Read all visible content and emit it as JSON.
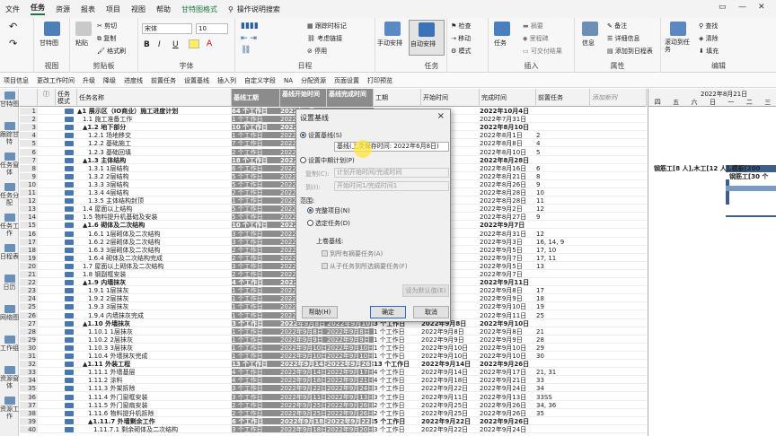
{
  "menu": {
    "items": [
      "文件",
      "任务",
      "资源",
      "报表",
      "项目",
      "视图",
      "帮助",
      "甘特图格式"
    ],
    "active_index": 1,
    "search": "操作说明搜索"
  },
  "ribbon": {
    "gantt_label": "甘特图",
    "paste_label": "粘贴",
    "cut": "剪切",
    "copy": "复制",
    "format_painter": "格式刷",
    "font_name": "宋体",
    "font_size": "10",
    "bold": "B",
    "italic": "I",
    "underline": "U",
    "mark_on_track": "跟踪时标记",
    "respect_links": "考虑链接",
    "inactivate": "停用",
    "manual_schedule": "手动安排",
    "auto_schedule": "自动安排",
    "inspect": "检查",
    "move": "移动",
    "mode": "模式",
    "task": "任务",
    "summary": "摘要",
    "milestone": "里程碑",
    "deliverable": "可交付结果",
    "info": "信息",
    "notes": "备注",
    "details": "详细信息",
    "add_to_timeline": "添加到日程表",
    "scroll_to_task": "滚动到任务",
    "find": "查找",
    "clear": "清除",
    "fill": "填充",
    "groups": {
      "view": "视图",
      "clipboard": "剪贴板",
      "font": "字体",
      "schedule": "日程",
      "tasks": "任务",
      "insert": "插入",
      "properties": "属性",
      "editing": "编辑"
    }
  },
  "quick_toolbar": [
    "项目信息",
    "更改工作时间",
    "升级",
    "降级",
    "进度线",
    "前置任务",
    "设置基线",
    "插入列",
    "自定义字段",
    "NA",
    "分配资源",
    "页面设置",
    "打印预览"
  ],
  "left_views": [
    "甘特图",
    "跟踪甘特",
    "任务窗体",
    "任务分配",
    "任务工作",
    "日程表",
    "日历",
    "网络图",
    "工作组",
    "资源窗体",
    "资源工作"
  ],
  "table": {
    "headers": {
      "mode": "任务模式",
      "name": "任务名称",
      "duration": "基线工期",
      "baseline_start": "基线开始时间",
      "baseline_finish": "基线完成时间",
      "work": "工期",
      "start": "开始时间",
      "finish": "完成时间",
      "pred": "前置任务",
      "add": "添加新列"
    },
    "rows": [
      {
        "id": "1",
        "name": "▲1 展示区（IO商业）施工进度计划",
        "dur": "64 个工作日",
        "bs": "2022年8月1",
        "bf": "",
        "work": "",
        "start": "",
        "fin": "2022年10月4日",
        "pred": "",
        "bold": true
      },
      {
        "id": "2",
        "name": "1.1 施工准备工作",
        "dur": "1 个工作日",
        "bs": "2022年7月3",
        "bf": "",
        "work": "",
        "start": "",
        "fin": "2022年7月31日",
        "pred": "",
        "bold": false
      },
      {
        "id": "3",
        "name": "▲1.2 地下部分",
        "dur": "10 个工作日",
        "bs": "2022年8月1",
        "bf": "",
        "work": "",
        "start": "",
        "fin": "2022年8月10日",
        "pred": "",
        "bold": true
      },
      {
        "id": "4",
        "name": "1.2.1 场地移交",
        "dur": "1 个工作日",
        "bs": "2022年8月1",
        "bf": "",
        "work": "",
        "start": "",
        "fin": "2022年8月1日",
        "pred": "2",
        "bold": false
      },
      {
        "id": "5",
        "name": "1.2.2 基础施工",
        "dur": "7 个工作日",
        "bs": "2022年8月2",
        "bf": "",
        "work": "",
        "start": "",
        "fin": "2022年8月8日",
        "pred": "4",
        "bold": false
      },
      {
        "id": "6",
        "name": "1.2.3 基础回填",
        "dur": "2 个工作日",
        "bs": "2022年8月9",
        "bf": "",
        "work": "",
        "start": "",
        "fin": "2022年8月10日",
        "pred": "5",
        "bold": false
      },
      {
        "id": "7",
        "name": "▲1.3 主体结构",
        "dur": "18 个工作日",
        "bs": "2022年8月1",
        "bf": "",
        "work": "",
        "start": "",
        "fin": "2022年8月28日",
        "pred": "",
        "bold": true
      },
      {
        "id": "8",
        "name": "1.3.1 1层结构",
        "dur": "6 个工作日",
        "bs": "2022年8月1",
        "bf": "",
        "work": "",
        "start": "",
        "fin": "2022年8月16日",
        "pred": "6",
        "bold": false
      },
      {
        "id": "9",
        "name": "1.3.2 2层结构",
        "dur": "5 个工作日",
        "bs": "2022年8月1",
        "bf": "",
        "work": "",
        "start": "",
        "fin": "2022年8月21日",
        "pred": "8",
        "bold": false
      },
      {
        "id": "10",
        "name": "1.3.3 3层结构",
        "dur": "5 个工作日",
        "bs": "2022年8月2",
        "bf": "",
        "work": "",
        "start": "",
        "fin": "2022年8月26日",
        "pred": "9",
        "bold": false
      },
      {
        "id": "11",
        "name": "1.3.4 4层结构",
        "dur": "2 个工作日",
        "bs": "2022年8月2",
        "bf": "",
        "work": "",
        "start": "",
        "fin": "2022年8月28日",
        "pred": "10",
        "bold": false
      },
      {
        "id": "12",
        "name": "1.3.5 主体结构封顶",
        "dur": "1 个工作日",
        "bs": "2022年8月2",
        "bf": "",
        "work": "",
        "start": "",
        "fin": "2022年8月28日",
        "pred": "11",
        "bold": false
      },
      {
        "id": "13",
        "name": "1.4 屋面以上结构",
        "dur": "5 个工作日",
        "bs": "2022年8月2",
        "bf": "",
        "work": "",
        "start": "",
        "fin": "2022年9月2日",
        "pred": "12",
        "bold": false
      },
      {
        "id": "14",
        "name": "1.5 物料提升机基础及安装",
        "dur": "5 个工作日",
        "bs": "2022年8月2",
        "bf": "",
        "work": "",
        "start": "",
        "fin": "2022年8月27日",
        "pred": "9",
        "bold": false
      },
      {
        "id": "15",
        "name": "▲1.6 砌体及二次结构",
        "dur": "10 个工作日",
        "bs": "2022年8月2",
        "bf": "",
        "work": "",
        "start": "",
        "fin": "2022年9月7日",
        "pred": "",
        "bold": true
      },
      {
        "id": "16",
        "name": "1.6.1 1层砌体及二次结构",
        "dur": "3 个工作日",
        "bs": "2022年8月2",
        "bf": "",
        "work": "",
        "start": "",
        "fin": "2022年8月31日",
        "pred": "12",
        "bold": false
      },
      {
        "id": "17",
        "name": "1.6.2 2层砌体及二次结构",
        "dur": "3 个工作日",
        "bs": "2022年9月1",
        "bf": "",
        "work": "",
        "start": "",
        "fin": "2022年9月3日",
        "pred": "16, 14, 9",
        "bold": false
      },
      {
        "id": "18",
        "name": "1.6.3 3层砌体及二次结构",
        "dur": "2 个工作日",
        "bs": "2022年9月4",
        "bf": "",
        "work": "",
        "start": "",
        "fin": "2022年9月5日",
        "pred": "17, 10",
        "bold": false
      },
      {
        "id": "19",
        "name": "1.6.4 砌体及二次结构完成",
        "dur": "2 个工作日",
        "bs": "2022年9月6",
        "bf": "",
        "work": "",
        "start": "",
        "fin": "2022年9月7日",
        "pred": "17, 11",
        "bold": false
      },
      {
        "id": "20",
        "name": "1.7 屋面以上砌体及二次结构",
        "dur": "3 个工作日",
        "bs": "2022年9月3",
        "bf": "",
        "work": "",
        "start": "",
        "fin": "2022年9月5日",
        "pred": "13",
        "bold": false
      },
      {
        "id": "21",
        "name": "1.8 钢副框安装",
        "dur": "2 个工作日",
        "bs": "2022年9月6",
        "bf": "",
        "work": "",
        "start": "",
        "fin": "2022年9月7日",
        "pred": "",
        "bold": false
      },
      {
        "id": "22",
        "name": "▲1.9 内墙抹灰",
        "dur": "4 个工作日",
        "bs": "2022年9月8",
        "bf": "",
        "work": "",
        "start": "",
        "fin": "2022年9月11日",
        "pred": "",
        "bold": true
      },
      {
        "id": "23",
        "name": "1.9.1 1层抹灰",
        "dur": "1 个工作日",
        "bs": "2022年9月8",
        "bf": "",
        "work": "",
        "start": "",
        "fin": "2022年9月8日",
        "pred": "17",
        "bold": false
      },
      {
        "id": "24",
        "name": "1.9.2 2层抹灰",
        "dur": "1 个工作日",
        "bs": "2022年9月9",
        "bf": "",
        "work": "",
        "start": "",
        "fin": "2022年9月9日",
        "pred": "18",
        "bold": false
      },
      {
        "id": "25",
        "name": "1.9.3 3层抹灰",
        "dur": "1 个工作日",
        "bs": "2022年9月1",
        "bf": "",
        "work": "",
        "start": "",
        "fin": "2022年9月10日",
        "pred": "19",
        "bold": false
      },
      {
        "id": "26",
        "name": "1.9.4 内墙抹灰完成",
        "dur": "1 个工作日",
        "bs": "2022年9月1",
        "bf": "",
        "work": "",
        "start": "",
        "fin": "2022年9月11日",
        "pred": "25",
        "bold": false
      },
      {
        "id": "27",
        "name": "▲1.10 外墙抹灰",
        "dur": "3 个工作日",
        "bs": "2022年9月8日",
        "bf": "2022年9月10日",
        "work": "3 个工作日",
        "start": "2022年9月8日",
        "fin": "2022年9月10日",
        "pred": "",
        "bold": true
      },
      {
        "id": "28",
        "name": "1.10.1 1层抹灰",
        "dur": "1 个工作日",
        "bs": "2022年9月8日",
        "bf": "2022年9月8日",
        "work": "1 个工作日",
        "start": "2022年9月8日",
        "fin": "2022年9月8日",
        "pred": "21",
        "bold": false
      },
      {
        "id": "29",
        "name": "1.10.2 2层抹灰",
        "dur": "1 个工作日",
        "bs": "2022年9月9日",
        "bf": "2022年9月9日",
        "work": "1 个工作日",
        "start": "2022年9月9日",
        "fin": "2022年9月9日",
        "pred": "28",
        "bold": false
      },
      {
        "id": "30",
        "name": "1.10.3 3层抹灰",
        "dur": "1 个工作日",
        "bs": "2022年9月10日",
        "bf": "2022年9月10日",
        "work": "1 个工作日",
        "start": "2022年9月10日",
        "fin": "2022年9月10日",
        "pred": "29",
        "bold": false
      },
      {
        "id": "31",
        "name": "1.10.4 外墙抹灰完成",
        "dur": "1 个工作日",
        "bs": "2022年9月10日",
        "bf": "2022年9月10日",
        "work": "1 个工作日",
        "start": "2022年9月10日",
        "fin": "2022年9月10日",
        "pred": "30",
        "bold": false
      },
      {
        "id": "32",
        "name": "▲1.11 外装工程",
        "dur": "13 个工作日",
        "bs": "2022年9月14日",
        "bf": "2022年9月26日",
        "work": "13 个工作日",
        "start": "2022年9月14日",
        "fin": "2022年9月26日",
        "pred": "",
        "bold": true
      },
      {
        "id": "33",
        "name": "1.11.1 外墙基层",
        "dur": "4 个工作日",
        "bs": "2022年9月14日",
        "bf": "2022年9月17日",
        "work": "4 个工作日",
        "start": "2022年9月14日",
        "fin": "2022年9月17日",
        "pred": "21, 31",
        "bold": false
      },
      {
        "id": "34",
        "name": "1.11.2 涂料",
        "dur": "4 个工作日",
        "bs": "2022年9月18日",
        "bf": "2022年9月21日",
        "work": "4 个工作日",
        "start": "2022年9月18日",
        "fin": "2022年9月21日",
        "pred": "33",
        "bold": false
      },
      {
        "id": "35",
        "name": "1.11.3 外架拆除",
        "dur": "3 个工作日",
        "bs": "2022年9月22日",
        "bf": "2022年9月24日",
        "work": "3 个工作日",
        "start": "2022年9月22日",
        "fin": "2022年9月24日",
        "pred": "34",
        "bold": false
      },
      {
        "id": "36",
        "name": "1.11.4 外门窗框安装",
        "dur": "3 个工作日",
        "bs": "2022年9月11日",
        "bf": "2022年9月13日",
        "work": "3 个工作日",
        "start": "2022年9月11日",
        "fin": "2022年9月13日",
        "pred": "33SS",
        "bold": false
      },
      {
        "id": "37",
        "name": "1.11.5 外门窗扇安装",
        "dur": "2 个工作日",
        "bs": "2022年9月25日",
        "bf": "2022年9月26日",
        "work": "2 个工作日",
        "start": "2022年9月25日",
        "fin": "2022年9月26日",
        "pred": "34, 36",
        "bold": false
      },
      {
        "id": "38",
        "name": "1.11.6 物料提升机拆除",
        "dur": "2 个工作日",
        "bs": "2022年9月25日",
        "bf": "2022年9月26日",
        "work": "2 个工作日",
        "start": "2022年9月25日",
        "fin": "2022年9月26日",
        "pred": "35",
        "bold": false
      },
      {
        "id": "39",
        "name": "▲1.11.7 外墙剩余工作",
        "dur": "6 个工作日",
        "bs": "2022年9月18日",
        "bf": "2022年9月22日",
        "work": "5 个工作日",
        "start": "2022年9月22日",
        "fin": "2022年9月26日",
        "pred": "",
        "bold": true
      },
      {
        "id": "40",
        "name": "1.11.7.1 剩余砌体及二次结构",
        "dur": "3 个工作日",
        "bs": "2022年9月18日",
        "bf": "2022年9月20日",
        "work": "3 个工作日",
        "start": "2022年9月22日",
        "fin": "2022年9月24日",
        "pred": "",
        "bold": false
      }
    ]
  },
  "gantt": {
    "date_header": "2022年8月21日",
    "days": [
      "四",
      "五",
      "六",
      "日",
      "一",
      "二",
      "三"
    ],
    "bar_label_1": "钢筋工[8 人],木工[12 人],模板[200",
    "bar_label_2": "钢筋工[30 个"
  },
  "dialog": {
    "title": "设置基线",
    "opt_set_baseline": "设置基线(S)",
    "baseline_select": "基线(上次保存时间: 2022年6月8日)",
    "opt_set_interim": "设置中期计划(P)",
    "copy_label": "复制(C):",
    "copy_value": "计划开始时间/完成时间",
    "to_label": "到(I):",
    "to_value": "开始时间1/完成时间1",
    "scope_label": "范围:",
    "opt_entire": "完整项目(N)",
    "opt_selected": "选定任务(D)",
    "rollup_label": "上卷基线:",
    "chk_all_summary": "到所有摘要任务(A)",
    "chk_from_sub": "从子任务到所选摘要任务(F)",
    "set_default": "设为默认值(E)",
    "help": "帮助(H)",
    "ok": "确定",
    "cancel": "取消"
  },
  "colors": {
    "accent": "#217346",
    "baseline_col_bg": "#8c8c8c",
    "gantt_bar": "#3e5f8a"
  }
}
